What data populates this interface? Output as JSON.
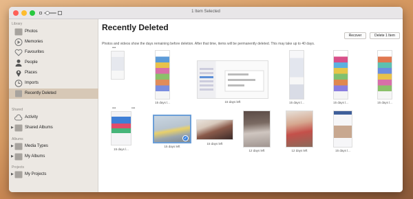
{
  "window": {
    "title": "1 Item Selected",
    "colors": {
      "close": "#fe5f57",
      "minimize": "#febc2e",
      "zoom": "#28c840",
      "selection": "#d7c8b6",
      "checkmark": "#3a82e0"
    }
  },
  "sidebar": {
    "library_label": "Library",
    "library_items": [
      {
        "label": "Photos",
        "icon": "photos-icon"
      },
      {
        "label": "Memories",
        "icon": "memories-icon"
      },
      {
        "label": "Favourites",
        "icon": "heart-icon"
      },
      {
        "label": "People",
        "icon": "person-icon"
      },
      {
        "label": "Places",
        "icon": "pin-icon"
      },
      {
        "label": "Imports",
        "icon": "clock-icon"
      },
      {
        "label": "Recently Deleted",
        "icon": "trash-icon",
        "selected": true
      }
    ],
    "shared_label": "Shared",
    "shared_items": [
      {
        "label": "Activity",
        "icon": "cloud-icon"
      },
      {
        "label": "Shared Albums",
        "icon": "folder-icon"
      }
    ],
    "albums_label": "Albums",
    "album_items": [
      {
        "label": "Media Types",
        "icon": "folder-icon"
      },
      {
        "label": "My Albums",
        "icon": "folder-icon"
      }
    ],
    "projects_label": "Projects",
    "project_items": [
      {
        "label": "My Projects",
        "icon": "folder-icon"
      }
    ]
  },
  "main": {
    "title": "Recently Deleted",
    "recover_label": "Recover",
    "delete_label": "Delete 1 Item",
    "info": "Photos and videos show the days remaining before deletion. After that time, items will be permanently deleted. This may take up to 40 days.",
    "more_glyph": "•••",
    "checkmark_glyph": "✓",
    "row1_captions": [
      "",
      "15 days l...",
      "15 days left",
      "15 days l...",
      "15 days l...",
      "15 days l..."
    ],
    "row2_captions": [
      "15 days l...",
      "15 days left",
      "15 days left",
      "12 days left",
      "12 days left",
      "15 days l..."
    ]
  }
}
